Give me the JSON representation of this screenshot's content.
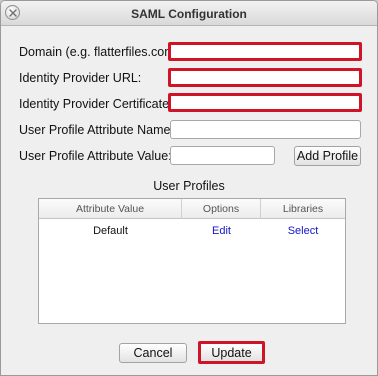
{
  "window": {
    "title": "SAML Configuration"
  },
  "form": {
    "domain_label": "Domain (e.g. flatterfiles.com):",
    "idp_url_label": "Identity Provider URL:",
    "idp_cert_label": "Identity Provider Certificate:",
    "attr_name_label": "User Profile Attribute Name:",
    "attr_value_label": "User Profile Attribute Value:",
    "domain_value": "",
    "idp_url_value": "",
    "idp_cert_value": "",
    "attr_name_value": "",
    "attr_value_value": "",
    "add_profile_label": "Add Profile"
  },
  "profiles": {
    "title": "User Profiles",
    "columns": [
      "Attribute Value",
      "Options",
      "Libraries"
    ],
    "rows": [
      {
        "attribute_value": "Default",
        "options": "Edit",
        "libraries": "Select"
      }
    ]
  },
  "footer": {
    "cancel_label": "Cancel",
    "update_label": "Update"
  },
  "colors": {
    "required_highlight": "#cf1428",
    "link": "#1515c8"
  }
}
